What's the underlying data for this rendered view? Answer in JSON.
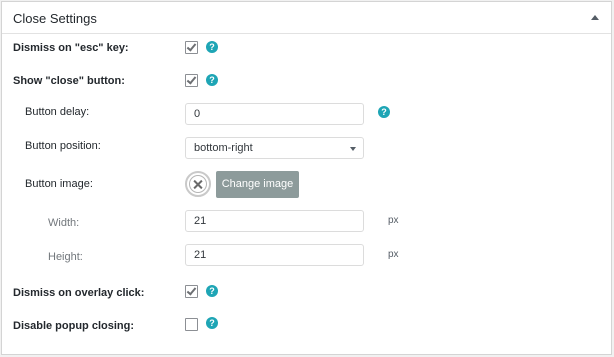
{
  "panel": {
    "title": "Close Settings"
  },
  "rows": {
    "dismiss_esc": {
      "label": "Dismiss on \"esc\" key:",
      "checked": true
    },
    "show_close": {
      "label": "Show \"close\" button:",
      "checked": true
    },
    "button_delay": {
      "label": "Button delay:",
      "value": "0"
    },
    "button_position": {
      "label": "Button position:",
      "selected": "bottom-right"
    },
    "button_image": {
      "label": "Button image:",
      "button_label": "Change image"
    },
    "width": {
      "label": "Width:",
      "value": "21",
      "unit": "px"
    },
    "height": {
      "label": "Height:",
      "value": "21",
      "unit": "px"
    },
    "dismiss_overlay": {
      "label": "Dismiss on overlay click:",
      "checked": true
    },
    "disable_closing": {
      "label": "Disable popup closing:",
      "checked": false
    }
  },
  "help_glyph": "?",
  "colors": {
    "accent_help": "#1ea5b5",
    "change_button": "#8d9b9b"
  }
}
